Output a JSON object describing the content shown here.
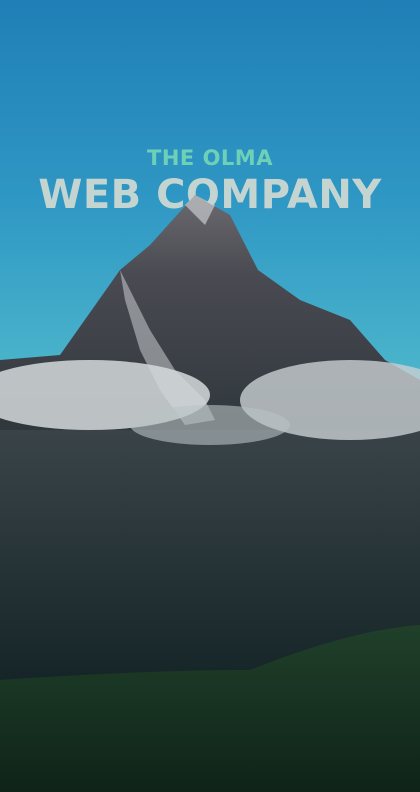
{
  "hero": {
    "subtitle": "THE OLMA",
    "title": "WEB COMPANY",
    "background": "mountain-peak-with-clouds",
    "colors": {
      "subtitle": "#6fd0b8",
      "title": "#c4d4d0",
      "sky": "#2f97c4"
    }
  }
}
